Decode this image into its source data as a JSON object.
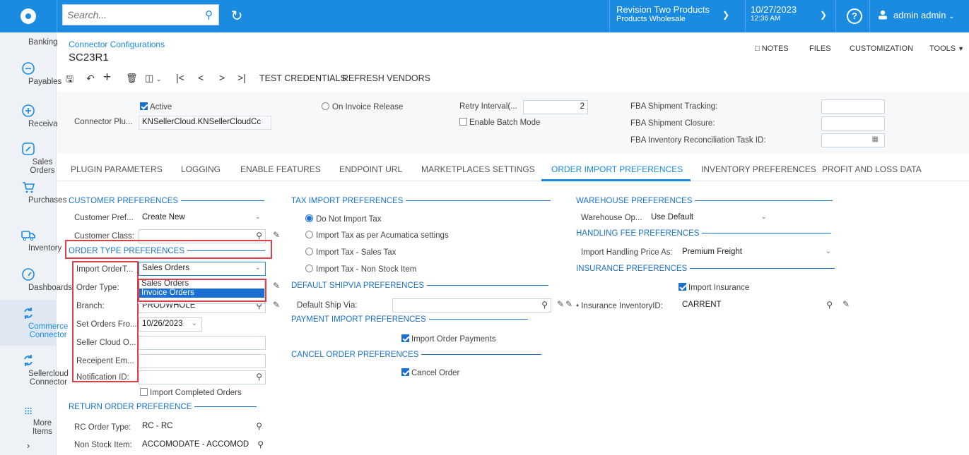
{
  "topbar": {
    "search_placeholder": "Search...",
    "company_name": "Revision Two Products",
    "company_branch": "Products Wholesale",
    "date": "10/27/2023",
    "time": "12:36 AM",
    "user": "admin admin"
  },
  "sidebar": {
    "items": [
      {
        "label": "Banking"
      },
      {
        "label": "Payables"
      },
      {
        "label": "Receivables"
      },
      {
        "label": "Sales Orders"
      },
      {
        "label": "Purchases"
      },
      {
        "label": "Inventory"
      },
      {
        "label": "Dashboards"
      },
      {
        "label": "Commerce Connector"
      },
      {
        "label": "Sellercloud Connector"
      },
      {
        "label": "More Items"
      }
    ]
  },
  "header": {
    "breadcrumb": "Connector Configurations",
    "title": "SC23R1",
    "links": {
      "notes": "NOTES",
      "files": "FILES",
      "customization": "CUSTOMIZATION",
      "tools": "TOOLS"
    }
  },
  "toolbar": {
    "test_credentials": "TEST CREDENTIALS",
    "refresh_vendors": "REFRESH VENDORS"
  },
  "form": {
    "active_label": "Active",
    "connector_plugin_label": "Connector Plu...",
    "connector_plugin_value": "KNSellerCloud.KNSellerCloudCc",
    "on_invoice_release": "On Invoice Release",
    "retry_interval_label": "Retry Interval(...",
    "retry_interval_value": "2",
    "enable_batch_mode": "Enable Batch Mode",
    "fba_tracking_label": "FBA Shipment Tracking:",
    "fba_closure_label": "FBA Shipment Closure:",
    "fba_recon_label": "FBA Inventory Reconciliation Task ID:"
  },
  "tabs": [
    "PLUGIN PARAMETERS",
    "LOGGING",
    "ENABLE FEATURES",
    "ENDPOINT URL",
    "MARKETPLACES SETTINGS",
    "ORDER IMPORT PREFERENCES",
    "INVENTORY PREFERENCES",
    "PROFIT AND LOSS DATA"
  ],
  "customer_prefs": {
    "header": "CUSTOMER PREFERENCES",
    "customer_pref_label": "Customer Pref...",
    "customer_pref_value": "Create New",
    "customer_class_label": "Customer Class:"
  },
  "order_type_prefs": {
    "header": "ORDER TYPE PREFERENCES",
    "import_order_label": "Import OrderT...",
    "import_order_value": "Sales Orders",
    "order_type_label": "Order Type:",
    "branch_label": "Branch:",
    "branch_value": "PRODWHOLE",
    "set_orders_label": "Set Orders Fro...",
    "set_orders_value": "10/26/2023",
    "seller_cloud_label": "Seller Cloud O...",
    "receipent_label": "Receipent Em...",
    "notification_label": "Notification ID:",
    "import_completed": "Import Completed Orders",
    "dropdown_options": [
      "Sales Orders",
      "Invoice Orders"
    ]
  },
  "return_prefs": {
    "header": "RETURN ORDER PREFERENCE",
    "rc_label": "RC Order Type:",
    "rc_value": "RC - RC",
    "non_stock_label": "Non Stock Item:",
    "non_stock_value": "ACCOMODATE - ACCOMOD"
  },
  "tax_prefs": {
    "header": "TAX IMPORT PREFERENCES",
    "opt1": "Do Not Import Tax",
    "opt2": "Import Tax as per Acumatica settings",
    "opt3": "Import Tax - Sales Tax",
    "opt4": "Import Tax - Non Stock Item"
  },
  "shipvia_prefs": {
    "header": "DEFAULT SHIPVIA PREFERENCES",
    "label": "Default Ship Via:"
  },
  "payment_prefs": {
    "header": "PAYMENT IMPORT PREFERENCES",
    "import_payments": "Import Order Payments"
  },
  "cancel_prefs": {
    "header": "CANCEL ORDER PREFERENCES",
    "cancel_order": "Cancel Order"
  },
  "warehouse_prefs": {
    "header": "WAREHOUSE PREFERENCES",
    "label": "Warehouse Op...",
    "value": "Use Default"
  },
  "handling_prefs": {
    "header": "HANDLING FEE PREFERENCES",
    "label": "Import Handling Price As:",
    "value": "Premium Freight"
  },
  "insurance_prefs": {
    "header": "INSURANCE PREFERENCES",
    "import_insurance": "Import Insurance",
    "inventory_label": "Insurance InventoryID:",
    "inventory_value": "CARRENT"
  },
  "colors": {
    "accent": "#1a8be0",
    "highlight": "#d9404a"
  }
}
